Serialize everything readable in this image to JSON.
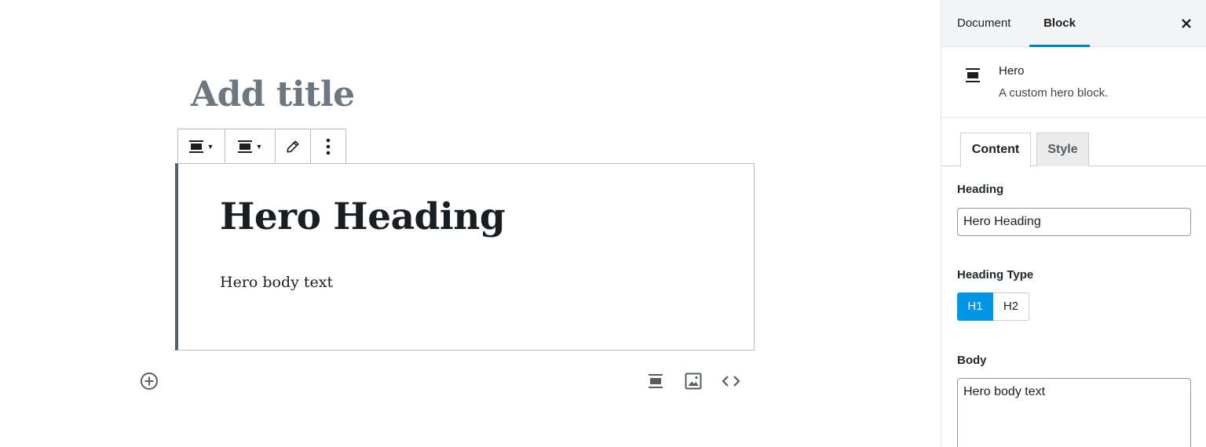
{
  "editor": {
    "title_placeholder": "Add title",
    "toolbar": {
      "buttons": [
        {
          "icon": "block-align-icon",
          "has_dropdown": true
        },
        {
          "icon": "text-align-icon",
          "has_dropdown": true
        },
        {
          "icon": "pencil-icon",
          "has_dropdown": false
        },
        {
          "icon": "more-vertical-icon",
          "has_dropdown": false
        }
      ]
    },
    "hero": {
      "heading": "Hero Heading",
      "body": "Hero body text"
    },
    "quick_inserter_icons": [
      "block-align-icon",
      "image-icon",
      "code-icon"
    ]
  },
  "sidebar": {
    "tabs": [
      {
        "label": "Document",
        "active": false
      },
      {
        "label": "Block",
        "active": true
      }
    ],
    "block_card": {
      "title": "Hero",
      "description": "A custom hero block."
    },
    "panel_tabs": [
      {
        "label": "Content",
        "active": true
      },
      {
        "label": "Style",
        "active": false
      }
    ],
    "fields": {
      "heading_label": "Heading",
      "heading_value": "Hero Heading",
      "heading_type_label": "Heading Type",
      "heading_type_options": [
        "H1",
        "H2"
      ],
      "heading_type_selected": "H1",
      "body_label": "Body",
      "body_value": "Hero body text"
    }
  },
  "colors": {
    "accent": "#0085ba",
    "active_segment": "#0096e6",
    "title_placeholder": "#6c7781",
    "text": "#191e23"
  }
}
